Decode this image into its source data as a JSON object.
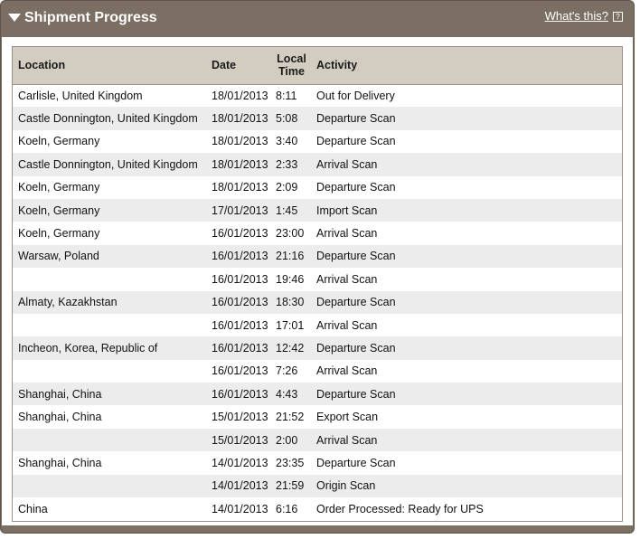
{
  "panel": {
    "title": "Shipment Progress",
    "help_link": "What's this?",
    "help_icon": "help-icon"
  },
  "table": {
    "columns": {
      "location": "Location",
      "date": "Date",
      "time_line1": "Local",
      "time_line2": "Time",
      "activity": "Activity"
    },
    "rows": [
      {
        "location": "Carlisle, United Kingdom",
        "date": "18/01/2013",
        "time": "8:11",
        "activity": "Out for Delivery"
      },
      {
        "location": "Castle Donnington, United Kingdom",
        "date": "18/01/2013",
        "time": "5:08",
        "activity": "Departure Scan"
      },
      {
        "location": "Koeln, Germany",
        "date": "18/01/2013",
        "time": "3:40",
        "activity": "Departure Scan"
      },
      {
        "location": "Castle Donnington, United Kingdom",
        "date": "18/01/2013",
        "time": "2:33",
        "activity": "Arrival Scan"
      },
      {
        "location": "Koeln, Germany",
        "date": "18/01/2013",
        "time": "2:09",
        "activity": "Departure Scan"
      },
      {
        "location": "Koeln, Germany",
        "date": "17/01/2013",
        "time": "1:45",
        "activity": "Import Scan"
      },
      {
        "location": "Koeln, Germany",
        "date": "16/01/2013",
        "time": "23:00",
        "activity": "Arrival Scan"
      },
      {
        "location": "Warsaw, Poland",
        "date": "16/01/2013",
        "time": "21:16",
        "activity": "Departure Scan"
      },
      {
        "location": "",
        "date": "16/01/2013",
        "time": "19:46",
        "activity": "Arrival Scan"
      },
      {
        "location": "Almaty, Kazakhstan",
        "date": "16/01/2013",
        "time": "18:30",
        "activity": "Departure Scan"
      },
      {
        "location": "",
        "date": "16/01/2013",
        "time": "17:01",
        "activity": "Arrival Scan"
      },
      {
        "location": "Incheon, Korea, Republic of",
        "date": "16/01/2013",
        "time": "12:42",
        "activity": "Departure Scan"
      },
      {
        "location": "",
        "date": "16/01/2013",
        "time": "7:26",
        "activity": "Arrival Scan"
      },
      {
        "location": "Shanghai, China",
        "date": "16/01/2013",
        "time": "4:43",
        "activity": "Departure Scan"
      },
      {
        "location": "Shanghai, China",
        "date": "15/01/2013",
        "time": "21:52",
        "activity": "Export Scan"
      },
      {
        "location": "",
        "date": "15/01/2013",
        "time": "2:00",
        "activity": "Arrival Scan"
      },
      {
        "location": "Shanghai, China",
        "date": "14/01/2013",
        "time": "23:35",
        "activity": "Departure Scan"
      },
      {
        "location": "",
        "date": "14/01/2013",
        "time": "21:59",
        "activity": "Origin Scan"
      },
      {
        "location": "China",
        "date": "14/01/2013",
        "time": "6:16",
        "activity": "Order Processed: Ready for UPS"
      }
    ]
  }
}
